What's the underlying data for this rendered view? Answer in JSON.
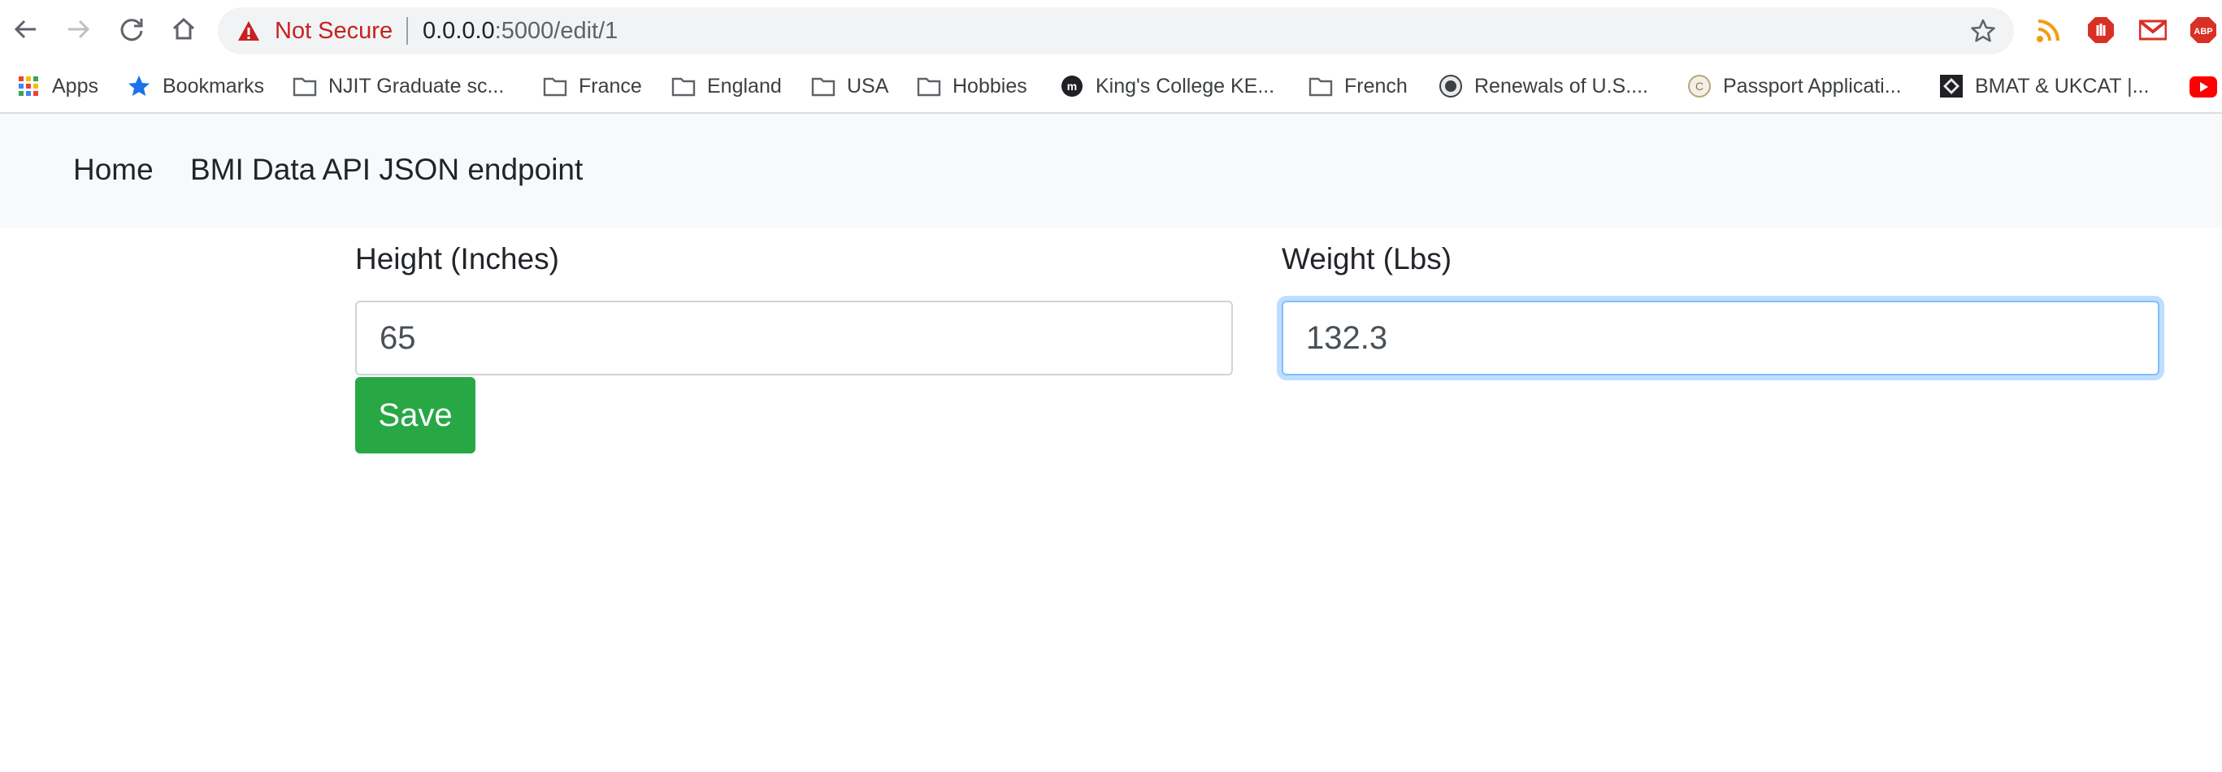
{
  "browser": {
    "security_label": "Not Secure",
    "url_host": "0.0.0.0",
    "url_path": ":5000/edit/1",
    "icons": {
      "back": "back-arrow-icon",
      "forward": "forward-arrow-icon",
      "reload": "reload-icon",
      "home": "home-icon",
      "warning": "warning-triangle-icon",
      "star": "bookmark-star-icon"
    },
    "extensions": [
      "rss-icon",
      "stop-hand-icon",
      "gmail-icon",
      "adblock-plus-icon"
    ]
  },
  "bookmarks": [
    {
      "label": "Apps",
      "icon": "apps-grid-icon"
    },
    {
      "label": "Bookmarks",
      "icon": "star-icon"
    },
    {
      "label": "NJIT Graduate sc...",
      "icon": "folder-icon"
    },
    {
      "label": "France",
      "icon": "folder-icon"
    },
    {
      "label": "England",
      "icon": "folder-icon"
    },
    {
      "label": "USA",
      "icon": "folder-icon"
    },
    {
      "label": "Hobbies",
      "icon": "folder-icon"
    },
    {
      "label": "King's College KE...",
      "icon": "site-logo-icon"
    },
    {
      "label": "French",
      "icon": "folder-icon"
    },
    {
      "label": "Renewals of U.S....",
      "icon": "seal-icon"
    },
    {
      "label": "Passport Applicati...",
      "icon": "site-logo-icon"
    },
    {
      "label": "BMAT & UKCAT |...",
      "icon": "site-logo-icon"
    }
  ],
  "nav": {
    "home": "Home",
    "api": "BMI Data API JSON endpoint"
  },
  "form": {
    "height_label": "Height (Inches)",
    "height_value": "65",
    "weight_label": "Weight (Lbs)",
    "weight_value": "132.3",
    "save_label": "Save"
  },
  "colors": {
    "save_button": "#28a745",
    "not_secure": "#c5221f",
    "focus_ring": "#80bdff",
    "navbar_bg": "#f8f9fa"
  }
}
